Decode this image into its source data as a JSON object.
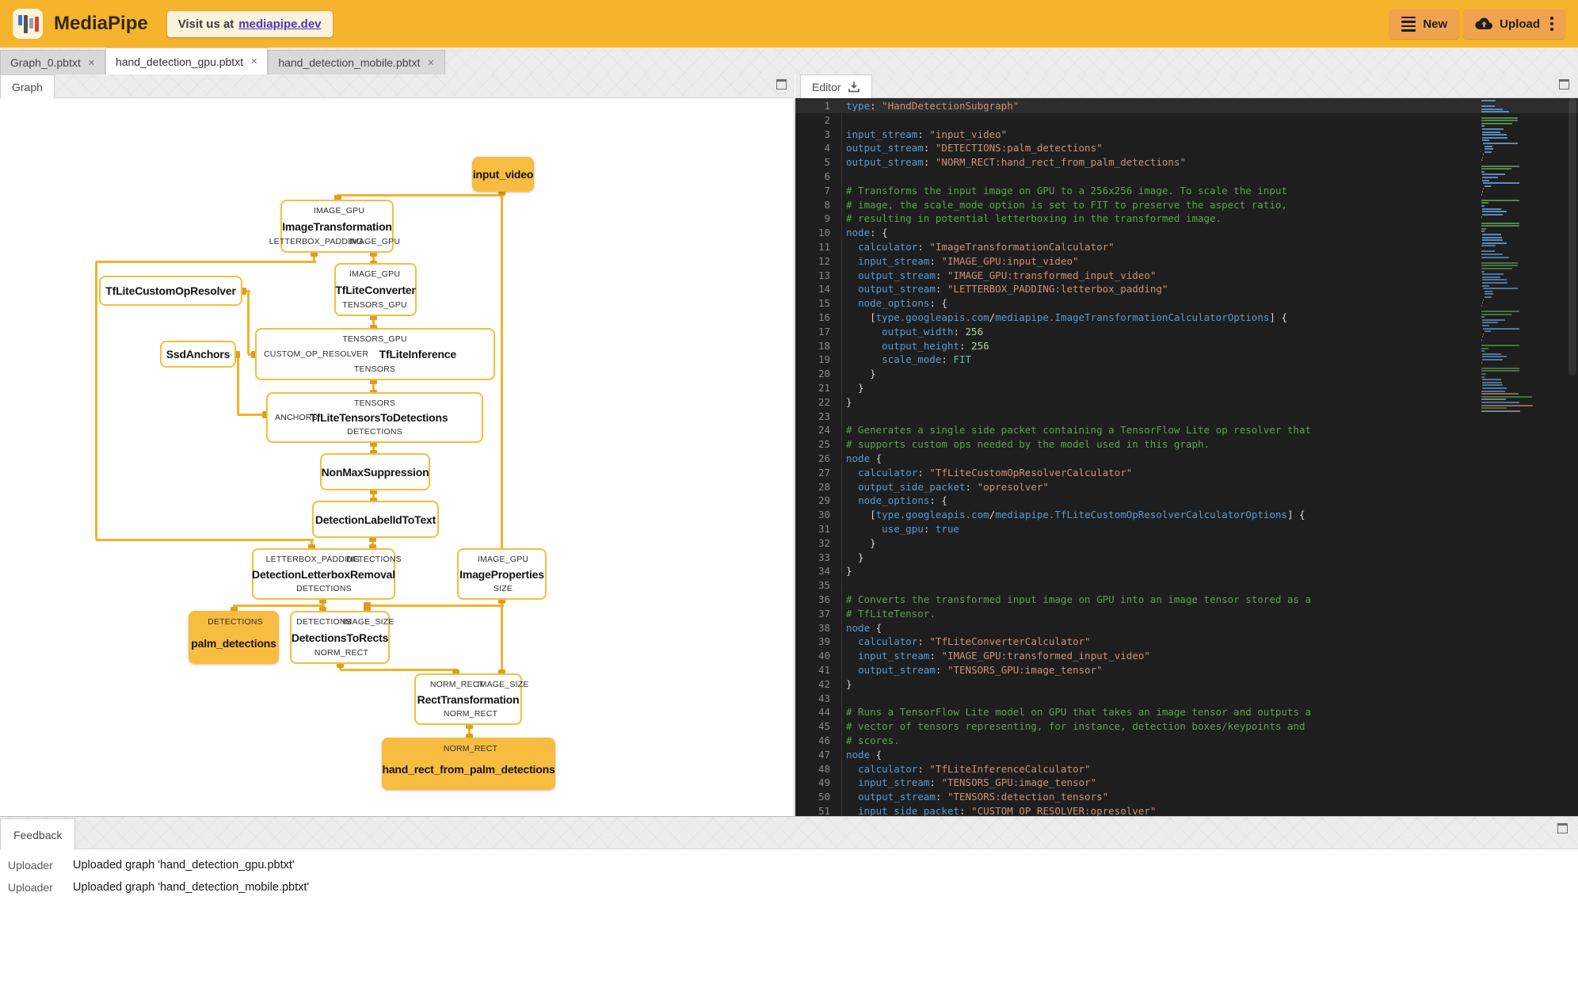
{
  "header": {
    "app_name": "MediaPipe",
    "visit_prefix": "Visit us at",
    "visit_link": "mediapipe.dev",
    "new_label": "New",
    "upload_label": "Upload"
  },
  "colors": {
    "header_bg": "#F6B42C",
    "header_button_bg": "#F0A24E",
    "link_purple": "#5633B5",
    "node_border": "#F5BD3F",
    "packet_fill": "#F8BC41",
    "edge": "#F1B32B",
    "port_square": "#DC9E1E",
    "editor_bg": "#1E1E1E",
    "code_key": "#569CD6",
    "code_string": "#CE9178",
    "code_comment": "#57A64A",
    "code_number": "#B5CEA8"
  },
  "tabs": [
    {
      "label": "Graph_0.pbtxt",
      "active": false,
      "close": "✕"
    },
    {
      "label": "hand_detection_gpu.pbtxt",
      "active": true,
      "close": "✕"
    },
    {
      "label": "hand_detection_mobile.pbtxt",
      "active": false,
      "close": "✕"
    }
  ],
  "graph_panel": {
    "tab_label": "Graph",
    "nodes": [
      {
        "id": "input_video",
        "title": "input_video",
        "kind": "packet"
      },
      {
        "id": "ImageTransformation",
        "title": "ImageTransformation",
        "kind": "calculator",
        "top_ports": [
          "IMAGE_GPU"
        ],
        "bottom_ports": [
          "LETTERBOX_PADDING",
          "IMAGE_GPU"
        ]
      },
      {
        "id": "TfLiteConverter",
        "title": "TfLiteConverter",
        "kind": "calculator",
        "top_ports": [
          "IMAGE_GPU"
        ],
        "bottom_ports": [
          "TENSORS_GPU"
        ]
      },
      {
        "id": "TfLiteCustomOpResolver",
        "title": "TfLiteCustomOpResolver",
        "kind": "calculator"
      },
      {
        "id": "SsdAnchors",
        "title": "SsdAnchors",
        "kind": "calculator"
      },
      {
        "id": "TfLiteInference",
        "title": "TfLiteInference",
        "kind": "calculator",
        "top_ports": [
          "TENSORS_GPU"
        ],
        "left_port": "CUSTOM_OP_RESOLVER",
        "bottom_ports": [
          "TENSORS"
        ]
      },
      {
        "id": "TfLiteTensorsToDetections",
        "title": "TfLiteTensorsToDetections",
        "kind": "calculator",
        "top_ports": [
          "TENSORS"
        ],
        "left_port": "ANCHORS",
        "bottom_ports": [
          "DETECTIONS"
        ]
      },
      {
        "id": "NonMaxSuppression",
        "title": "NonMaxSuppression",
        "kind": "calculator"
      },
      {
        "id": "DetectionLabelIdToText",
        "title": "DetectionLabelIdToText",
        "kind": "calculator"
      },
      {
        "id": "DetectionLetterboxRemoval",
        "title": "DetectionLetterboxRemoval",
        "kind": "calculator",
        "top_ports": [
          "LETTERBOX_PADDING",
          "DETECTIONS"
        ],
        "bottom_ports": [
          "DETECTIONS"
        ]
      },
      {
        "id": "ImageProperties",
        "title": "ImageProperties",
        "kind": "calculator",
        "top_ports": [
          "IMAGE_GPU"
        ],
        "bottom_ports": [
          "SIZE"
        ]
      },
      {
        "id": "palm_detections",
        "title": "palm_detections",
        "kind": "packet",
        "top_ports": [
          "DETECTIONS"
        ]
      },
      {
        "id": "DetectionsToRects",
        "title": "DetectionsToRects",
        "kind": "calculator",
        "top_ports": [
          "DETECTIONS",
          "IMAGE_SIZE"
        ],
        "bottom_ports": [
          "NORM_RECT"
        ]
      },
      {
        "id": "RectTransformation",
        "title": "RectTransformation",
        "kind": "calculator",
        "top_ports": [
          "NORM_RECT",
          "IMAGE_SIZE"
        ],
        "bottom_ports": [
          "NORM_RECT"
        ]
      },
      {
        "id": "hand_rect_from_palm_detections",
        "title": "hand_rect_from_palm_detections",
        "kind": "packet",
        "top_ports": [
          "NORM_RECT"
        ]
      }
    ]
  },
  "editor_panel": {
    "tab_label": "Editor",
    "lines": [
      [
        [
          "k",
          "type"
        ],
        [
          "p",
          ": "
        ],
        [
          "s",
          "\"HandDetectionSubgraph\""
        ]
      ],
      [],
      [
        [
          "k",
          "input_stream"
        ],
        [
          "p",
          ": "
        ],
        [
          "s",
          "\"input_video\""
        ]
      ],
      [
        [
          "k",
          "output_stream"
        ],
        [
          "p",
          ": "
        ],
        [
          "s",
          "\"DETECTIONS:palm_detections\""
        ]
      ],
      [
        [
          "k",
          "output_stream"
        ],
        [
          "p",
          ": "
        ],
        [
          "s",
          "\"NORM_RECT:hand_rect_from_palm_detections\""
        ]
      ],
      [],
      [
        [
          "c",
          "# Transforms the input image on GPU to a 256x256 image. To scale the input"
        ]
      ],
      [
        [
          "c",
          "# image, the scale_mode option is set to FIT to preserve the aspect ratio,"
        ]
      ],
      [
        [
          "c",
          "# resulting in potential letterboxing in the transformed image."
        ]
      ],
      [
        [
          "k",
          "node"
        ],
        [
          "p",
          ": {"
        ]
      ],
      [
        [
          "p",
          "  "
        ],
        [
          "k",
          "calculator"
        ],
        [
          "p",
          ": "
        ],
        [
          "s",
          "\"ImageTransformationCalculator\""
        ]
      ],
      [
        [
          "p",
          "  "
        ],
        [
          "k",
          "input_stream"
        ],
        [
          "p",
          ": "
        ],
        [
          "s",
          "\"IMAGE_GPU:input_video\""
        ]
      ],
      [
        [
          "p",
          "  "
        ],
        [
          "k",
          "output_stream"
        ],
        [
          "p",
          ": "
        ],
        [
          "s",
          "\"IMAGE_GPU:transformed_input_video\""
        ]
      ],
      [
        [
          "p",
          "  "
        ],
        [
          "k",
          "output_stream"
        ],
        [
          "p",
          ": "
        ],
        [
          "s",
          "\"LETTERBOX_PADDING:letterbox_padding\""
        ]
      ],
      [
        [
          "p",
          "  "
        ],
        [
          "k",
          "node_options"
        ],
        [
          "p",
          ": {"
        ]
      ],
      [
        [
          "p",
          "    ["
        ],
        [
          "k",
          "type"
        ],
        [
          "d",
          "."
        ],
        [
          "k",
          "googleapis"
        ],
        [
          "d",
          "."
        ],
        [
          "k",
          "com"
        ],
        [
          "p",
          "/"
        ],
        [
          "k",
          "mediapipe"
        ],
        [
          "d",
          "."
        ],
        [
          "k",
          "ImageTransformationCalculatorOptions"
        ],
        [
          "p",
          "] {"
        ]
      ],
      [
        [
          "p",
          "      "
        ],
        [
          "k",
          "output_width"
        ],
        [
          "p",
          ": "
        ],
        [
          "n",
          "256"
        ]
      ],
      [
        [
          "p",
          "      "
        ],
        [
          "k",
          "output_height"
        ],
        [
          "p",
          ": "
        ],
        [
          "n",
          "256"
        ]
      ],
      [
        [
          "p",
          "      "
        ],
        [
          "k",
          "scale_mode"
        ],
        [
          "p",
          ": "
        ],
        [
          "e",
          "FIT"
        ]
      ],
      [
        [
          "p",
          "    }"
        ]
      ],
      [
        [
          "p",
          "  }"
        ]
      ],
      [
        [
          "p",
          "}"
        ]
      ],
      [],
      [
        [
          "c",
          "# Generates a single side packet containing a TensorFlow Lite op resolver that"
        ]
      ],
      [
        [
          "c",
          "# supports custom ops needed by the model used in this graph."
        ]
      ],
      [
        [
          "k",
          "node"
        ],
        [
          "p",
          " {"
        ]
      ],
      [
        [
          "p",
          "  "
        ],
        [
          "k",
          "calculator"
        ],
        [
          "p",
          ": "
        ],
        [
          "s",
          "\"TfLiteCustomOpResolverCalculator\""
        ]
      ],
      [
        [
          "p",
          "  "
        ],
        [
          "k",
          "output_side_packet"
        ],
        [
          "p",
          ": "
        ],
        [
          "s",
          "\"opresolver\""
        ]
      ],
      [
        [
          "p",
          "  "
        ],
        [
          "k",
          "node_options"
        ],
        [
          "p",
          ": {"
        ]
      ],
      [
        [
          "p",
          "    ["
        ],
        [
          "k",
          "type"
        ],
        [
          "d",
          "."
        ],
        [
          "k",
          "googleapis"
        ],
        [
          "d",
          "."
        ],
        [
          "k",
          "com"
        ],
        [
          "p",
          "/"
        ],
        [
          "k",
          "mediapipe"
        ],
        [
          "d",
          "."
        ],
        [
          "k",
          "TfLiteCustomOpResolverCalculatorOptions"
        ],
        [
          "p",
          "] {"
        ]
      ],
      [
        [
          "p",
          "      "
        ],
        [
          "k",
          "use_gpu"
        ],
        [
          "p",
          ": "
        ],
        [
          "b",
          "true"
        ]
      ],
      [
        [
          "p",
          "    }"
        ]
      ],
      [
        [
          "p",
          "  }"
        ]
      ],
      [
        [
          "p",
          "}"
        ]
      ],
      [],
      [
        [
          "c",
          "# Converts the transformed input image on GPU into an image tensor stored as a"
        ]
      ],
      [
        [
          "c",
          "# TfLiteTensor."
        ]
      ],
      [
        [
          "k",
          "node"
        ],
        [
          "p",
          " {"
        ]
      ],
      [
        [
          "p",
          "  "
        ],
        [
          "k",
          "calculator"
        ],
        [
          "p",
          ": "
        ],
        [
          "s",
          "\"TfLiteConverterCalculator\""
        ]
      ],
      [
        [
          "p",
          "  "
        ],
        [
          "k",
          "input_stream"
        ],
        [
          "p",
          ": "
        ],
        [
          "s",
          "\"IMAGE_GPU:transformed_input_video\""
        ]
      ],
      [
        [
          "p",
          "  "
        ],
        [
          "k",
          "output_stream"
        ],
        [
          "p",
          ": "
        ],
        [
          "s",
          "\"TENSORS_GPU:image_tensor\""
        ]
      ],
      [
        [
          "p",
          "}"
        ]
      ],
      [],
      [
        [
          "c",
          "# Runs a TensorFlow Lite model on GPU that takes an image tensor and outputs a"
        ]
      ],
      [
        [
          "c",
          "# vector of tensors representing, for instance, detection boxes/keypoints and"
        ]
      ],
      [
        [
          "c",
          "# scores."
        ]
      ],
      [
        [
          "k",
          "node"
        ],
        [
          "p",
          " {"
        ]
      ],
      [
        [
          "p",
          "  "
        ],
        [
          "k",
          "calculator"
        ],
        [
          "p",
          ": "
        ],
        [
          "s",
          "\"TfLiteInferenceCalculator\""
        ]
      ],
      [
        [
          "p",
          "  "
        ],
        [
          "k",
          "input_stream"
        ],
        [
          "p",
          ": "
        ],
        [
          "s",
          "\"TENSORS_GPU:image_tensor\""
        ]
      ],
      [
        [
          "p",
          "  "
        ],
        [
          "k",
          "output_stream"
        ],
        [
          "p",
          ": "
        ],
        [
          "s",
          "\"TENSORS:detection_tensors\""
        ]
      ],
      [
        [
          "p",
          "  "
        ],
        [
          "k",
          "input_side_packet"
        ],
        [
          "p",
          ": "
        ],
        [
          "s",
          "\"CUSTOM_OP_RESOLVER:opresolver\""
        ]
      ]
    ]
  },
  "feedback_panel": {
    "tab_label": "Feedback",
    "messages": [
      {
        "source": "Uploader",
        "text": "Uploaded graph 'hand_detection_gpu.pbtxt'"
      },
      {
        "source": "Uploader",
        "text": "Uploaded graph 'hand_detection_mobile.pbtxt'"
      }
    ]
  }
}
